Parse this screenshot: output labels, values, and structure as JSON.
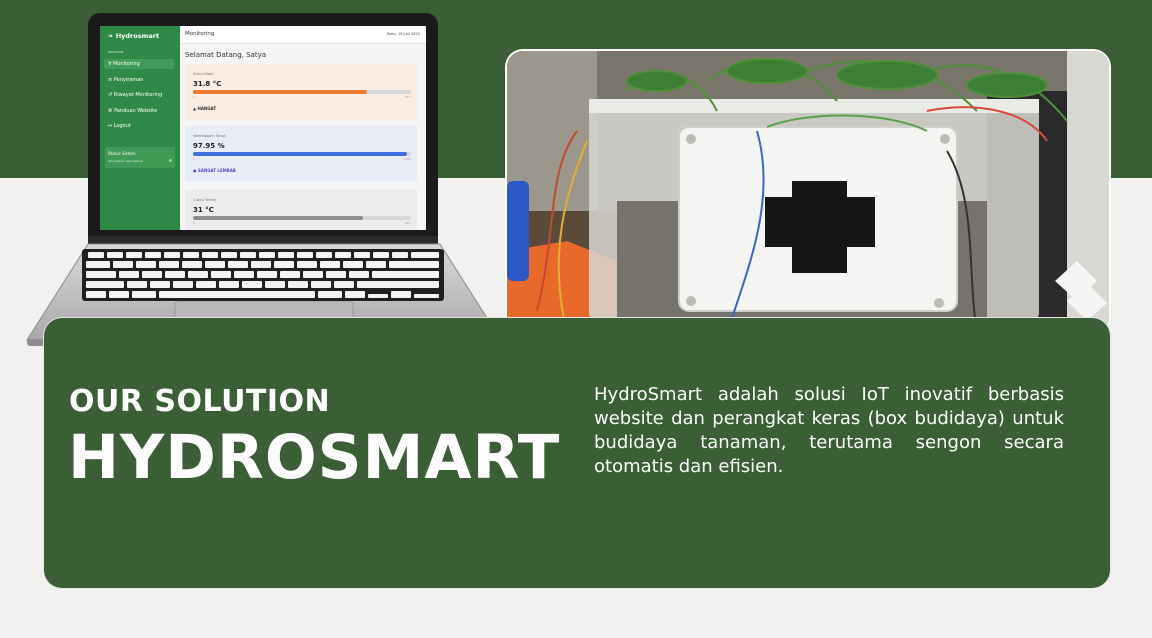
{
  "hero": {
    "kicker": "OUR SOLUTION",
    "brand": "HYDROSMART",
    "description": "HydroSmart adalah solusi IoT inovatif berbasis website dan perangkat keras (box budidaya) untuk budidaya tanaman, terutama sengon secara otomatis dan efisien."
  },
  "dashboard": {
    "logo": "Hydrosmart",
    "section_label": "SOLUTION",
    "menu": [
      "Monitoring",
      "Penyiraman",
      "Riwayat Monitoring",
      "Panduan Website",
      "Logout"
    ],
    "status_title": "Status Sistem",
    "status_text": "all systems operational",
    "page_title": "Monitoring",
    "date": "Rabu, 18 Juni 2025",
    "welcome": "Selamat Datang, Satya",
    "cards": [
      {
        "label": "Suhu Udara",
        "value": "31.8 °C",
        "level": 0.8,
        "color": "#ee7a30",
        "status": "HANGAT",
        "status_color": "#333333",
        "bg": "#f9ece2",
        "min": "0",
        "max": "40°C"
      },
      {
        "label": "Kelembapan Tanah",
        "value": "97.95 %",
        "level": 0.98,
        "color": "#3f6fdf",
        "status": "SANGAT LEMBAB",
        "status_color": "#5a4bd0",
        "bg": "#e8ecf7",
        "min": "0",
        "max": "100%"
      },
      {
        "label": "Cuaca Terkini",
        "value": "31 °C",
        "level": 0.78,
        "color": "#8e8e8e",
        "status": "",
        "status_color": "#333333",
        "bg": "#ececec",
        "min": "0",
        "max": "40°C"
      }
    ]
  },
  "colors": {
    "brand_green": "#3b5e36",
    "sidebar_green": "#2f8a48",
    "background": "#f1f1f0"
  }
}
